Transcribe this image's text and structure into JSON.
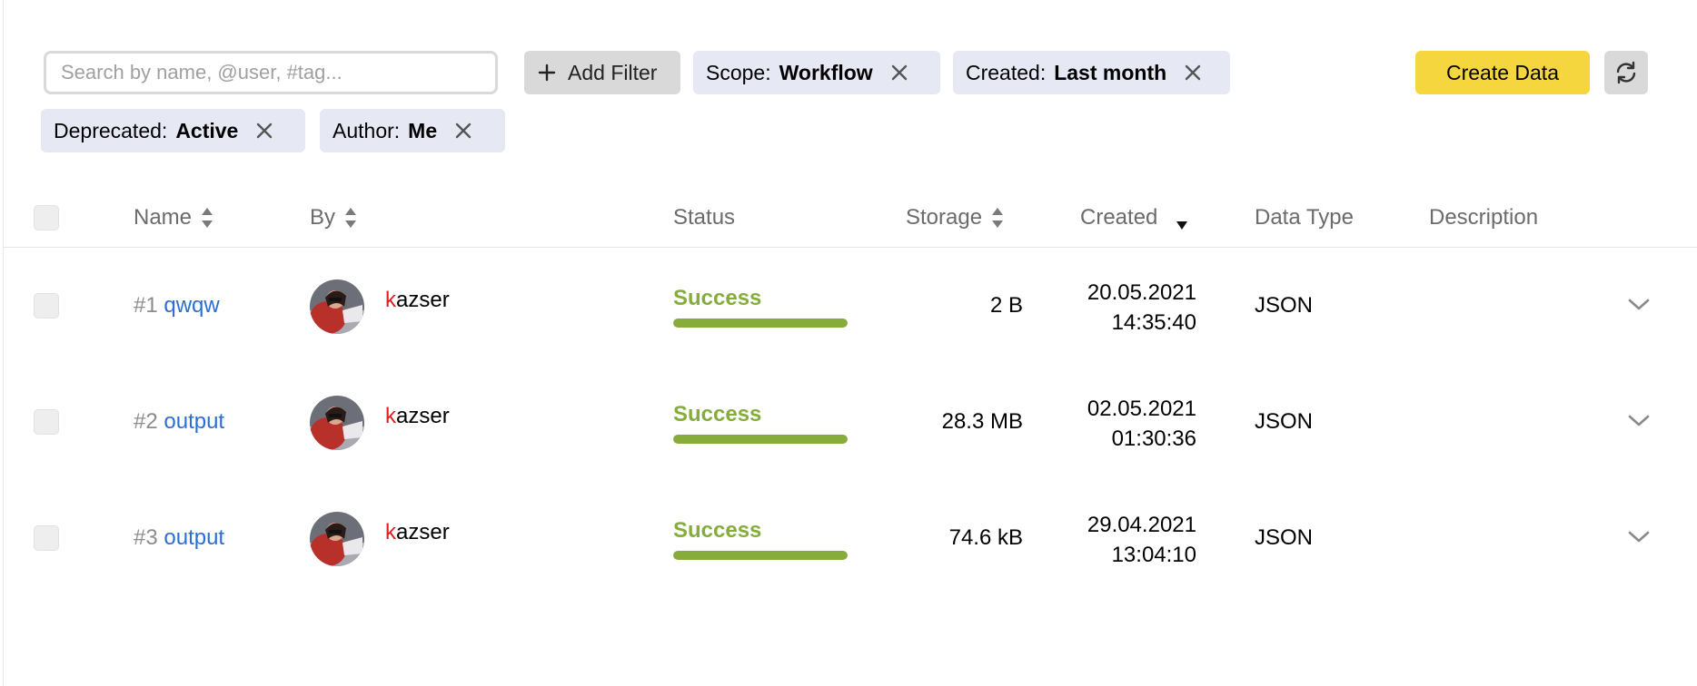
{
  "toolbar": {
    "search_placeholder": "Search by name, @user, #tag...",
    "add_filter_label": "Add Filter",
    "create_label": "Create Data"
  },
  "filters": [
    {
      "key": "Scope:",
      "value": "Workflow"
    },
    {
      "key": "Created:",
      "value": "Last month"
    },
    {
      "key": "Deprecated:",
      "value": "Active"
    },
    {
      "key": "Author:",
      "value": "Me"
    }
  ],
  "columns": {
    "name": "Name",
    "by": "By",
    "status": "Status",
    "storage": "Storage",
    "created": "Created",
    "data_type": "Data Type",
    "description": "Description"
  },
  "rows": [
    {
      "num": "#1",
      "name": "qwqw",
      "user_first": "k",
      "user_rest": "azser",
      "status": "Success",
      "progress": 1.0,
      "storage": "2 B",
      "date": "20.05.2021",
      "time": "14:35:40",
      "data_type": "JSON",
      "description": ""
    },
    {
      "num": "#2",
      "name": "output",
      "user_first": "k",
      "user_rest": "azser",
      "status": "Success",
      "progress": 1.0,
      "storage": "28.3 MB",
      "date": "02.05.2021",
      "time": "01:30:36",
      "data_type": "JSON",
      "description": ""
    },
    {
      "num": "#3",
      "name": "output",
      "user_first": "k",
      "user_rest": "azser",
      "status": "Success",
      "progress": 1.0,
      "storage": "74.6 kB",
      "date": "29.04.2021",
      "time": "13:04:10",
      "data_type": "JSON",
      "description": ""
    }
  ],
  "colors": {
    "accent_yellow": "#f6d63f",
    "success_green": "#86ad3c",
    "link_blue": "#2a6fd6",
    "chip_bg": "#e6e8f3"
  },
  "icons": {
    "add": "plus-icon",
    "remove": "close-icon",
    "refresh": "refresh-icon",
    "sort": "sort-arrows-icon",
    "sort_desc": "sort-desc-icon",
    "expand": "chevron-down-icon"
  }
}
